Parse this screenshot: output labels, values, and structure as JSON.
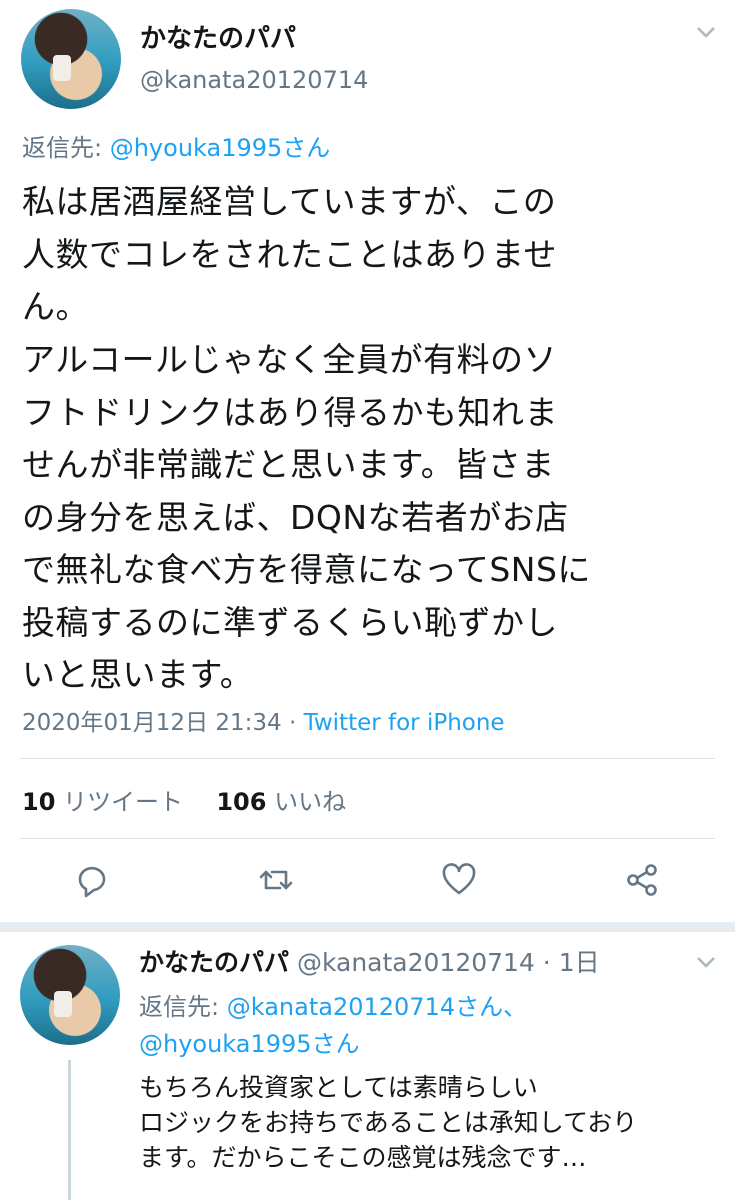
{
  "tweet": {
    "display_name": "かなたのパパ",
    "handle": "@kanata20120714",
    "reply_prefix": "返信先: ",
    "reply_to": "@hyouka1995さん",
    "body_lines": [
      "私は居酒屋経営していますが、この",
      "人数でコレをされたことはありませ",
      "ん。",
      "アルコールじゃなく全員が有料のソ",
      "フトドリンクはあり得るかも知れま",
      "せんが非常識だと思います。皆さま",
      "の身分を思えば、DQNな若者がお店",
      "で無礼な食べ方を得意になってSNSに",
      "投稿するのに準ずるくらい恥ずかし",
      "いと思います。"
    ],
    "timestamp": "2020年01月12日 21:34",
    "separator": " · ",
    "source": "Twitter for iPhone",
    "retweets_count": "10",
    "retweets_label": "リツイート",
    "likes_count": "106",
    "likes_label": "いいね"
  },
  "reply_tweet": {
    "display_name": "かなたのパパ",
    "handle_time": " @kanata20120714 · 1日",
    "reply_prefix": "返信先: ",
    "reply_to_1": "@kanata20120714さん、",
    "reply_to_2": "@hyouka1995さん",
    "body_lines": [
      "もちろん投資家としては素晴らしい",
      "ロジックをお持ちであることは承知しており",
      "ます。だからこそこの感覚は残念です…"
    ]
  },
  "icons": [
    "chevron-down-icon",
    "reply-icon",
    "retweet-icon",
    "like-icon",
    "share-icon"
  ],
  "colors": {
    "link": "#1da1f2",
    "muted": "#657786",
    "text": "#14171a",
    "divider": "#dfe3e6"
  }
}
